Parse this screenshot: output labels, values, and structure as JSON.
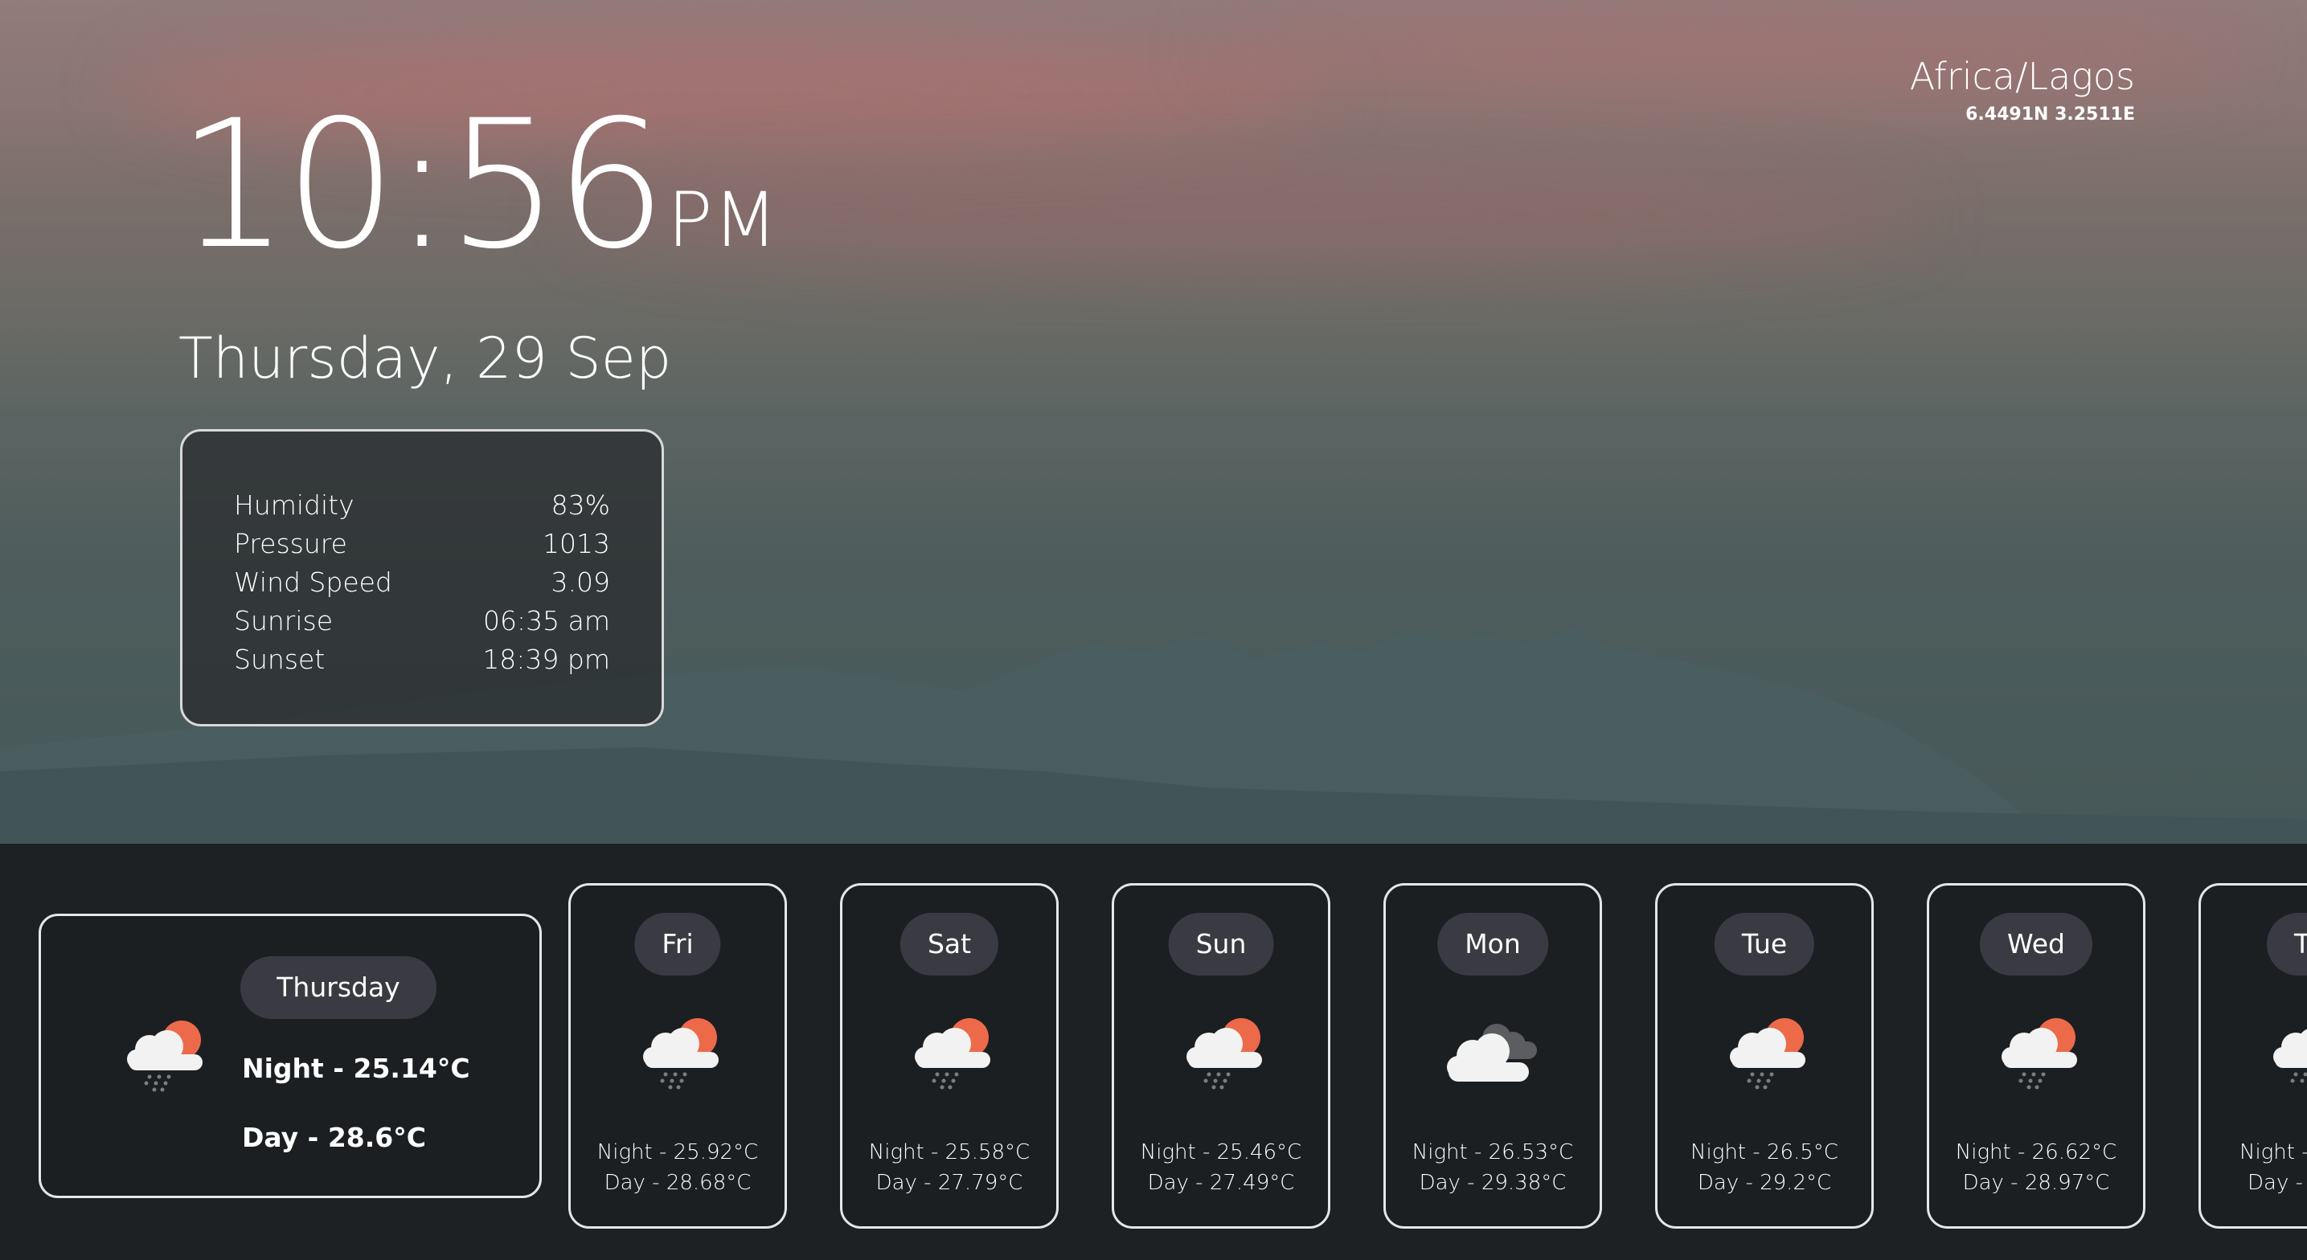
{
  "clock": {
    "time": "10:56",
    "ampm": "PM"
  },
  "date": "Thursday, 29 Sep",
  "location": {
    "timezone": "Africa/Lagos",
    "coords": "6.4491N 3.2511E"
  },
  "details": [
    {
      "label": "Humidity",
      "value": "83%"
    },
    {
      "label": "Pressure",
      "value": "1013"
    },
    {
      "label": "Wind Speed",
      "value": "3.09"
    },
    {
      "label": "Sunrise",
      "value": "06:35 am"
    },
    {
      "label": "Sunset",
      "value": "18:39 pm"
    }
  ],
  "today": {
    "day": "Thursday",
    "icon": "rain-partly-cloudy-icon",
    "night": "Night - 25.14°C",
    "day_temp": "Day - 28.6°C"
  },
  "forecast": [
    {
      "day": "Fri",
      "icon": "rain-partly-cloudy-icon",
      "night": "Night - 25.92°C",
      "day_temp": "Day - 28.68°C"
    },
    {
      "day": "Sat",
      "icon": "rain-partly-cloudy-icon",
      "night": "Night - 25.58°C",
      "day_temp": "Day - 27.79°C"
    },
    {
      "day": "Sun",
      "icon": "rain-partly-cloudy-icon",
      "night": "Night - 25.46°C",
      "day_temp": "Day - 27.49°C"
    },
    {
      "day": "Mon",
      "icon": "overcast-clouds-icon",
      "night": "Night - 26.53°C",
      "day_temp": "Day - 29.38°C"
    },
    {
      "day": "Tue",
      "icon": "rain-partly-cloudy-icon",
      "night": "Night - 26.5°C",
      "day_temp": "Day - 29.2°C"
    },
    {
      "day": "Wed",
      "icon": "rain-partly-cloudy-icon",
      "night": "Night - 26.62°C",
      "day_temp": "Day - 28.97°C"
    },
    {
      "day": "Th",
      "icon": "rain-partly-cloudy-icon",
      "night": "Night -",
      "day_temp": "Day -"
    }
  ],
  "colors": {
    "sun": "#ec6a4a",
    "cloud": "#f2f2f2",
    "dark_cloud": "#5b5d60",
    "pill": "#3a3b42",
    "panel": "#1b1f22"
  }
}
